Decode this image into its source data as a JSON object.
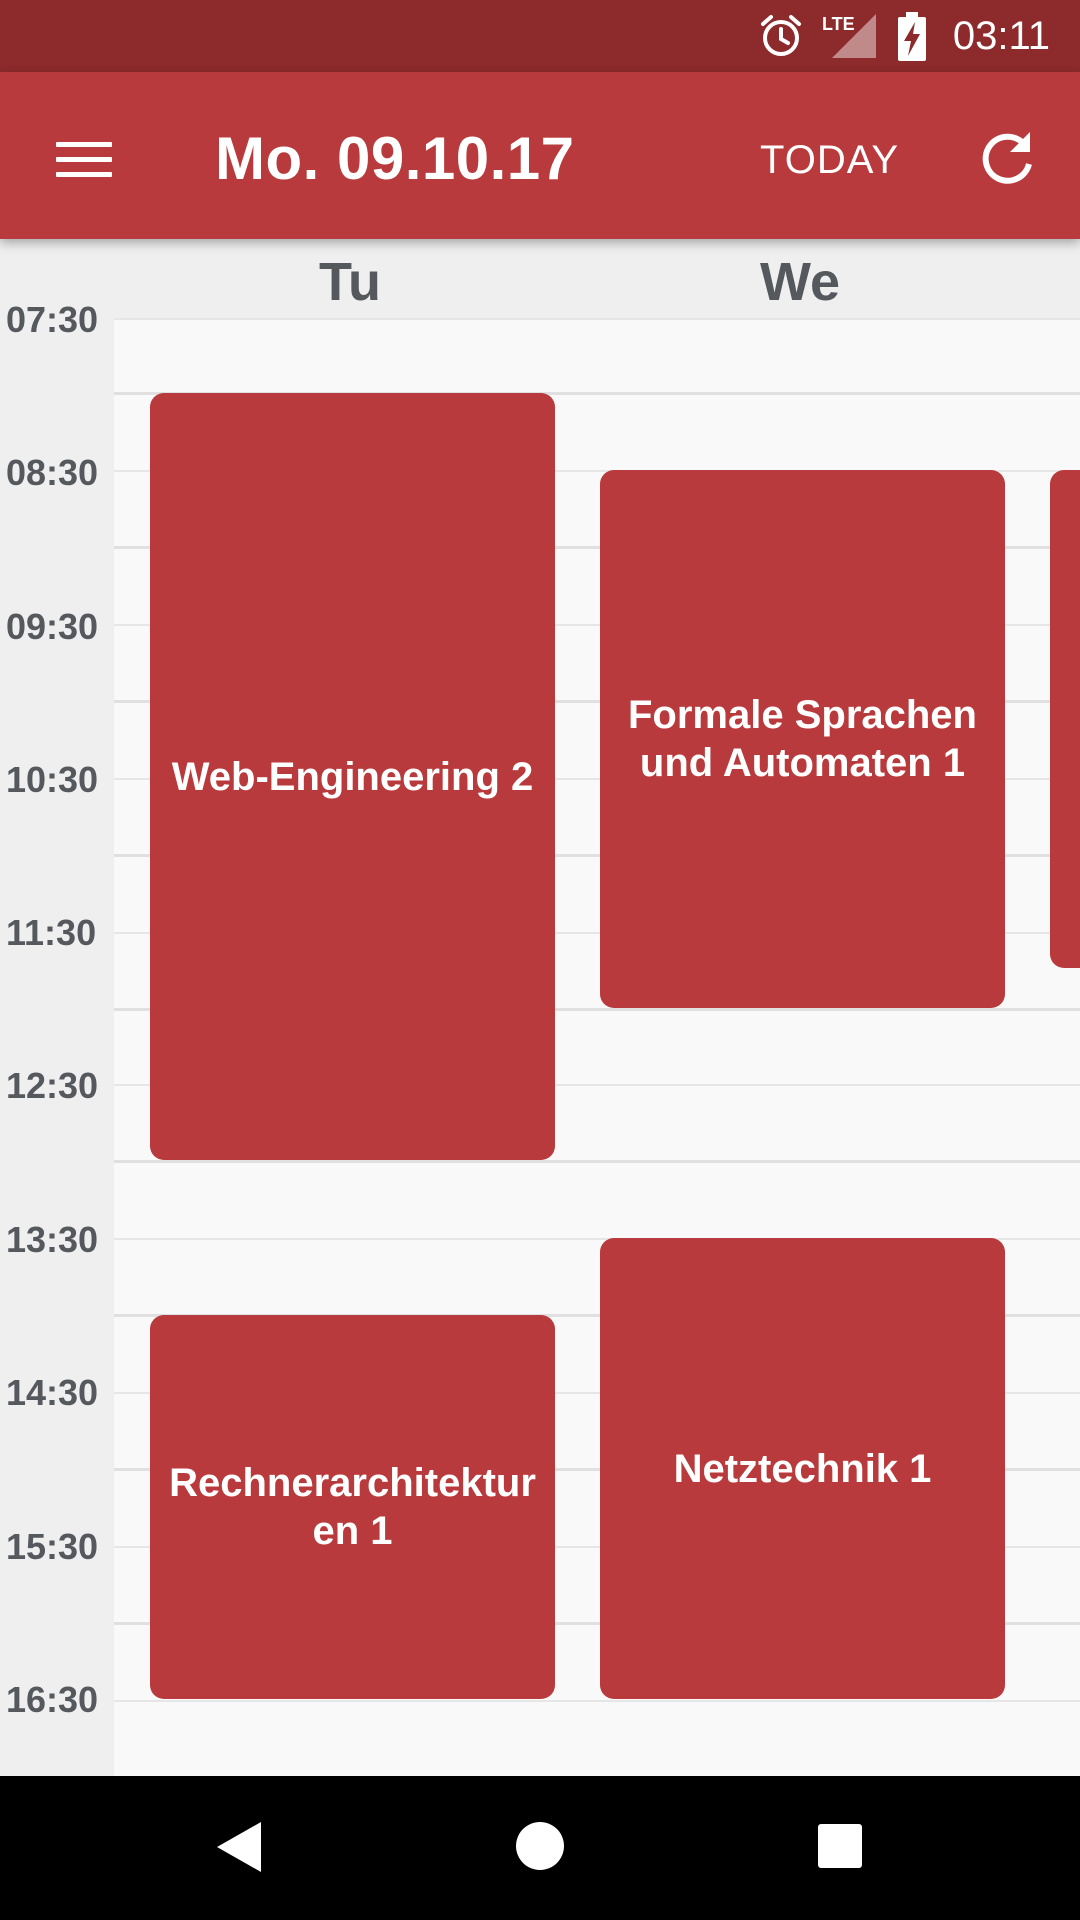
{
  "status_bar": {
    "time": "03:11",
    "icons": [
      "alarm-icon",
      "lte-signal-icon",
      "battery-charging-icon"
    ],
    "network_label": "LTE"
  },
  "app_bar": {
    "title": "Mo. 09.10.17",
    "today_label": "TODAY",
    "icons": [
      "menu-icon",
      "refresh-icon"
    ]
  },
  "days": [
    "Tu",
    "We"
  ],
  "times": [
    "07:30",
    "08:30",
    "09:30",
    "10:30",
    "11:30",
    "12:30",
    "13:30",
    "14:30",
    "15:30",
    "16:30"
  ],
  "events": [
    {
      "title": "Web-Engineering 2",
      "day": "Tu"
    },
    {
      "title": "Formale Sprachen und Automaten 1",
      "day": "We"
    },
    {
      "title": "Rechnerarchitekturen 1",
      "day": "Tu"
    },
    {
      "title": "Netztechnik 1",
      "day": "We"
    }
  ],
  "nav_bar": {
    "icons": [
      "back-icon",
      "home-icon",
      "recents-icon"
    ]
  },
  "colors": {
    "primary": "#b93a3c",
    "status_bar": "#8c2a2c",
    "event": "#b93a3c",
    "label_text": "#55585c",
    "background": "#f9f9f9"
  }
}
